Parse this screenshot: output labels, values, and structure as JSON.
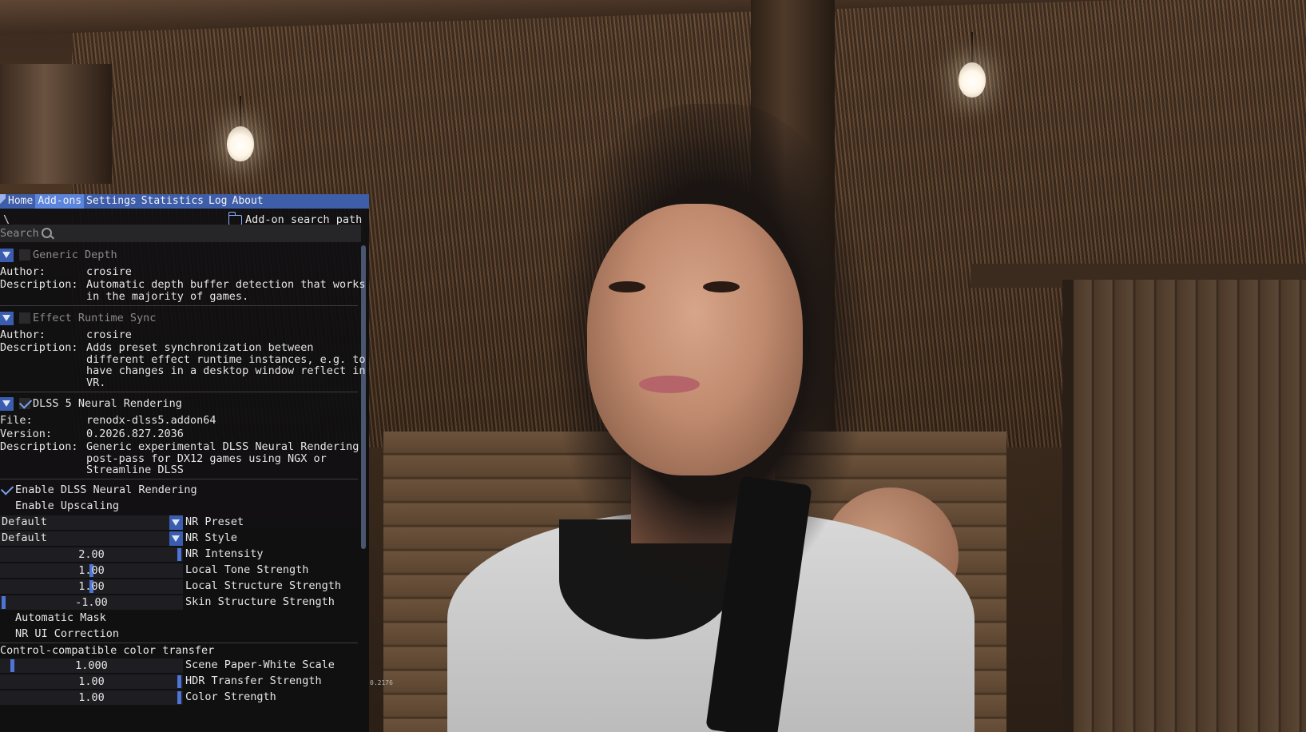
{
  "menu": {
    "tabs": [
      "Home",
      "Add-ons",
      "Settings",
      "Statistics",
      "Log",
      "About"
    ],
    "active": "Add-ons"
  },
  "path": {
    "current": "\\",
    "button_label": "Add-on search path"
  },
  "search": {
    "placeholder": "Search"
  },
  "labels": {
    "author": "Author:",
    "description": "Description:",
    "file": "File:",
    "version": "Version:"
  },
  "addons": [
    {
      "name": "Generic Depth",
      "enabled": false,
      "author": "crosire",
      "description_lines": [
        "Automatic depth buffer detection that works",
        "in the majority of games."
      ]
    },
    {
      "name": "Effect Runtime Sync",
      "enabled": false,
      "author": "crosire",
      "description_lines": [
        "Adds preset synchronization between",
        "different effect runtime instances, e.g. to",
        "have changes in a desktop window reflect in",
        "VR."
      ]
    },
    {
      "name": "DLSS 5 Neural Rendering",
      "enabled": true,
      "file": "renodx-dlss5.addon64",
      "version": "0.2026.827.2036",
      "description_lines": [
        "Generic experimental DLSS Neural Rendering",
        "post-pass for DX12 games using NGX or",
        "Streamline DLSS"
      ]
    }
  ],
  "settings": {
    "enable_dlss_nr": {
      "label": "Enable DLSS Neural Rendering",
      "checked": true
    },
    "enable_upscaling": {
      "label": "Enable Upscaling",
      "checked": false
    },
    "nr_preset": {
      "label": "NR Preset",
      "value": "Default"
    },
    "nr_style": {
      "label": "NR Style",
      "value": "Default"
    },
    "sliders": [
      {
        "label": "NR Intensity",
        "value": "2.00",
        "level": 1.0
      },
      {
        "label": "Local Tone Strength",
        "value": "1.00",
        "level": 0.5
      },
      {
        "label": "Local Structure Strength",
        "value": "1.00",
        "level": 0.5
      },
      {
        "label": "Skin Structure Strength",
        "value": "-1.00",
        "level": 0.0
      }
    ],
    "automatic_mask": {
      "label": "Automatic Mask",
      "checked": false
    },
    "nr_ui_correction": {
      "label": "NR UI Correction",
      "checked": false
    },
    "color_transfer_header": "Control-compatible color transfer",
    "color_sliders": [
      {
        "label": "Scene Paper-White Scale",
        "value": "1.000",
        "level": 0.05
      },
      {
        "label": "HDR Transfer Strength",
        "value": "1.00",
        "level": 1.0
      },
      {
        "label": "Color Strength",
        "value": "1.00",
        "level": 1.0
      }
    ]
  },
  "overlay_corner_text": "0.2176",
  "colors": {
    "menu_bar": "#3e5eaa",
    "active_tab": "#5b84dd",
    "accent": "#4d74d6",
    "panel_bg": "#0f0f11"
  }
}
